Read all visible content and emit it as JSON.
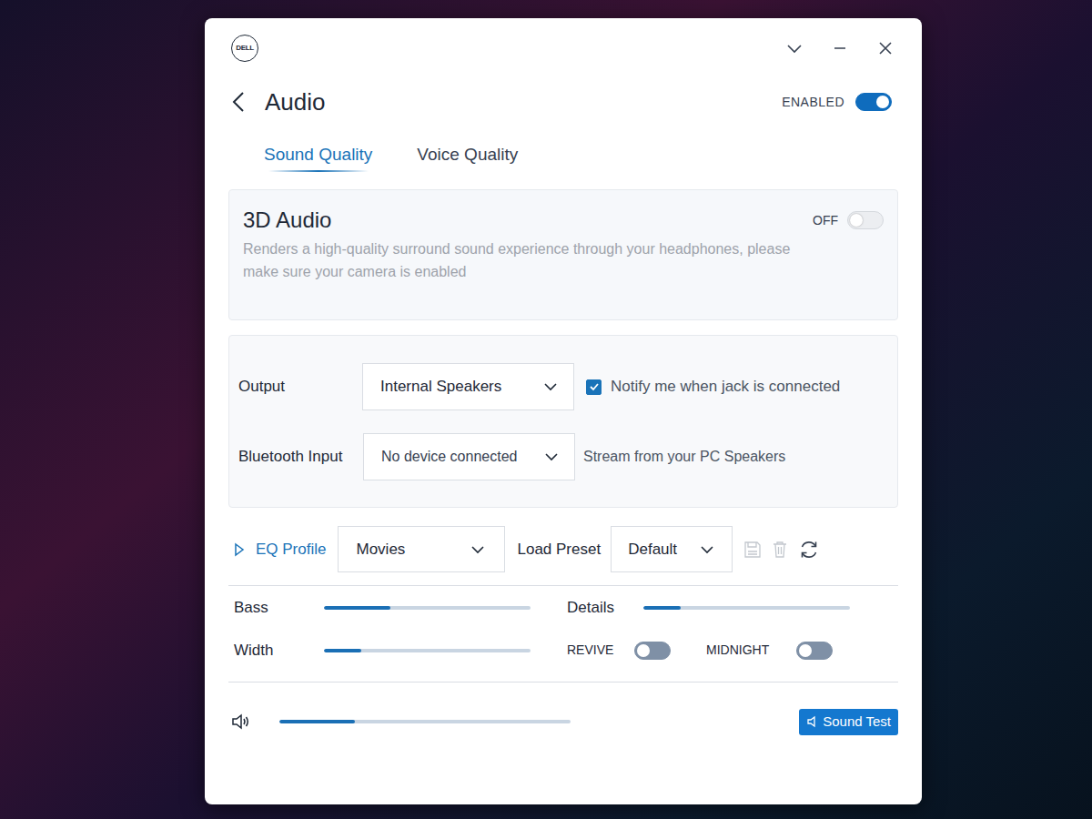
{
  "logo": {
    "text": "DELL"
  },
  "header": {
    "title": "Audio",
    "enabled_label": "ENABLED",
    "enabled": true
  },
  "tabs": [
    {
      "label": "Sound Quality",
      "selected": true
    },
    {
      "label": "Voice Quality",
      "selected": false
    }
  ],
  "audio3d": {
    "title": "3D Audio",
    "state_label": "OFF",
    "on": false,
    "description": "Renders a high-quality surround sound experience through your headphones, please make sure your camera is enabled"
  },
  "output": {
    "label": "Output",
    "value": "Internal Speakers",
    "notify_label": "Notify me when jack is connected",
    "notify_checked": true
  },
  "bluetooth": {
    "label": "Bluetooth Input",
    "value": "No device connected",
    "hint": "Stream from your PC Speakers"
  },
  "eq": {
    "label": "EQ Profile",
    "expanded": false,
    "profile": "Movies",
    "preset_label": "Load Preset",
    "preset": "Default",
    "save_disabled": true,
    "delete_disabled": true
  },
  "sliders": [
    {
      "label": "Bass",
      "level": 0.32
    },
    {
      "label": "Details",
      "level": 0.18
    },
    {
      "label": "Width",
      "level": 0.18
    }
  ],
  "toggles": [
    {
      "label": "REVIVE",
      "on": false
    },
    {
      "label": "MIDNIGHT",
      "on": false
    }
  ],
  "volume": {
    "level": 0.26
  },
  "sound_test": {
    "label": "Sound Test"
  }
}
